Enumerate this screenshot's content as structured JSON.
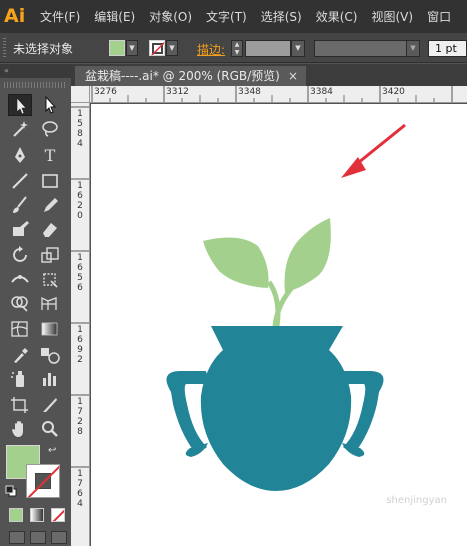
{
  "app": {
    "logo": "Ai"
  },
  "menu": [
    "文件(F)",
    "编辑(E)",
    "对象(O)",
    "文字(T)",
    "选择(S)",
    "效果(C)",
    "视图(V)",
    "窗口"
  ],
  "control_bar": {
    "selection_status": "未选择对象",
    "stroke_label": "描边:",
    "stroke_weight": "1 pt",
    "fill_color": "#a3d18d"
  },
  "document": {
    "tab_title": "盆栽稿----.ai* @ 200% (RGB/预览)",
    "close_glyph": "×"
  },
  "rulers": {
    "horizontal": [
      "3276",
      "3312",
      "3348",
      "3384",
      "3420"
    ],
    "vertical": [
      "1584",
      "1620",
      "1656",
      "1692",
      "1728",
      "1764"
    ]
  },
  "artwork": {
    "pot_color": "#228497",
    "leaf_color": "#a3d18d",
    "arrow_color": "#e2303a"
  },
  "watermark": "shenjingyan"
}
